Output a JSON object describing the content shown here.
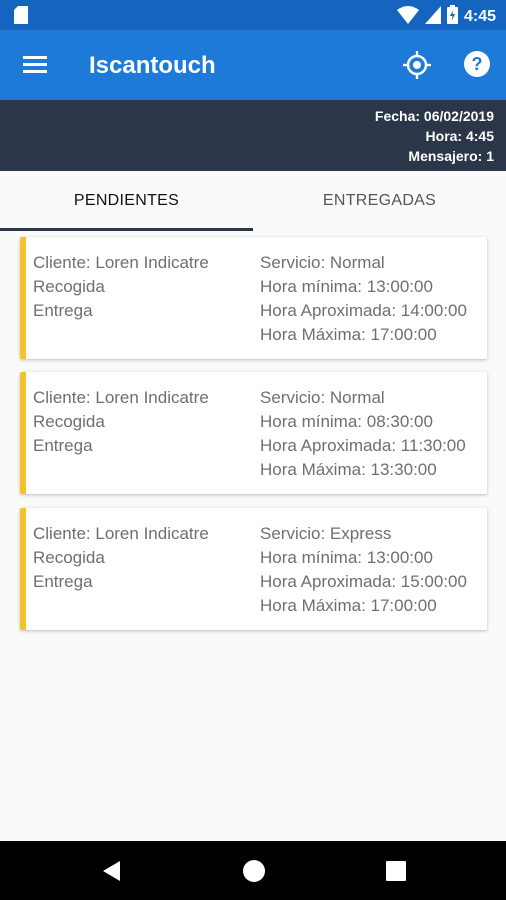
{
  "status_bar": {
    "time": "4:45",
    "icons": [
      "sd-card-icon",
      "wifi-icon",
      "cell-signal-icon",
      "battery-icon"
    ]
  },
  "app_bar": {
    "title": "Iscantouch",
    "icons": [
      "menu-icon",
      "location-icon",
      "help-icon"
    ]
  },
  "info": {
    "fecha": "Fecha: 06/02/2019",
    "hora": "Hora: 4:45",
    "mensajero": "Mensajero: 1"
  },
  "tabs": [
    {
      "label": "PENDIENTES",
      "selected": true
    },
    {
      "label": "ENTREGADAS",
      "selected": false
    }
  ],
  "orders": [
    {
      "cliente": "Cliente: Loren Indicatre",
      "recogida": "Recogida",
      "entrega": "Entrega",
      "servicio": "Servicio: Normal",
      "hora_minima": "Hora mínima: 13:00:00",
      "hora_aproximada": "Hora Aproximada: 14:00:00",
      "hora_maxima": "Hora Máxima: 17:00:00"
    },
    {
      "cliente": "Cliente: Loren Indicatre",
      "recogida": "Recogida",
      "entrega": "Entrega",
      "servicio": "Servicio: Normal",
      "hora_minima": "Hora mínima: 08:30:00",
      "hora_aproximada": "Hora Aproximada: 11:30:00",
      "hora_maxima": "Hora Máxima: 13:30:00"
    },
    {
      "cliente": "Cliente: Loren Indicatre",
      "recogida": "Recogida",
      "entrega": "Entrega",
      "servicio": "Servicio: Express",
      "hora_minima": "Hora mínima: 13:00:00",
      "hora_aproximada": "Hora Aproximada: 15:00:00",
      "hora_maxima": "Hora Máxima: 17:00:00"
    }
  ],
  "colors": {
    "status_bar": "#1565c0",
    "app_bar": "#1e7ad9",
    "info_bar": "#2b3748",
    "card_accent": "#f4c22b"
  },
  "nav_bar": {
    "icons": [
      "back-icon",
      "home-icon",
      "recent-apps-icon"
    ]
  }
}
